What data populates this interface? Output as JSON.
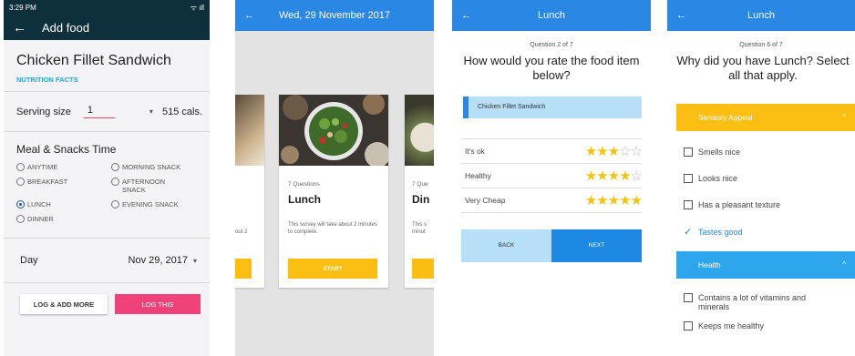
{
  "screen1": {
    "status_time": "3:29 PM",
    "status_icons": "ᯤ ıll",
    "back_icon": "←",
    "title": "Add food",
    "food_name": "Chicken Fillet Sandwich",
    "nutrition_link": "NUTRITION FACTS",
    "serving_label": "Serving size",
    "serving_value": "1",
    "serving_caret": "▾",
    "calories": "515 cals.",
    "meal_heading": "Meal & Snacks Time",
    "meal_options": [
      {
        "label": "ANYTIME",
        "selected": false
      },
      {
        "label": "MORNING SNACK",
        "selected": false
      },
      {
        "label": "BREAKFAST",
        "selected": false
      },
      {
        "label": "AFTERNOON SNACK",
        "selected": false
      },
      {
        "label": "LUNCH",
        "selected": true
      },
      {
        "label": "EVENING SNACK",
        "selected": false
      },
      {
        "label": "DINNER",
        "selected": false
      }
    ],
    "day_label": "Day",
    "day_value": "Nov 29, 2017",
    "day_caret": "▾",
    "log_more_label": "LOG & ADD MORE",
    "log_this_label": "LOG THIS"
  },
  "screen2": {
    "back_icon": "←",
    "title": "Wed, 29 November 2017",
    "left_card_desc": "out 2",
    "center_card": {
      "questions": "7 Questions",
      "title": "Lunch",
      "desc": "This survey will take about 2 minutes to complete.",
      "start_label": "START"
    },
    "right_card": {
      "questions": "7 Que",
      "title": "Din",
      "desc": "This s minut"
    }
  },
  "screen3": {
    "back_icon": "←",
    "title": "Lunch",
    "question_number": "Question 2 of 7",
    "question": "How would you rate the food item below?",
    "food_item": "Chicken Fillet Sandwich",
    "ratings": [
      {
        "label": "It's ok",
        "stars": 3
      },
      {
        "label": "Healthy",
        "stars": 4
      },
      {
        "label": "Very Cheap",
        "stars": 5
      }
    ],
    "back_label": "BACK",
    "next_label": "NEXT",
    "star_glyph": "★",
    "empty_star_glyph": "☆",
    "star_max": 5
  },
  "screen4": {
    "back_icon": "←",
    "title": "Lunch",
    "question_number": "Question 6 of 7",
    "question": "Why did you have Lunch? Select all that apply.",
    "sections": [
      {
        "title": "Sensory Appeal",
        "color": "#fbbf14",
        "chevron": "^",
        "items": [
          {
            "label": "Smells nice",
            "checked": false
          },
          {
            "label": "Looks nice",
            "checked": false
          },
          {
            "label": "Has a pleasant texture",
            "checked": false
          },
          {
            "label": "Tastes good",
            "checked": true
          }
        ]
      },
      {
        "title": "Health",
        "color": "#2ea6ee",
        "chevron": "^",
        "items": [
          {
            "label": "Contains a lot of vitamins and minerals",
            "checked": false
          },
          {
            "label": "Keeps me healthy",
            "checked": false
          }
        ]
      }
    ],
    "check_glyph": "✓"
  },
  "colors": {
    "dark_header": "#0e2f3c",
    "blue_header": "#2b87e4",
    "accent_pink": "#f0427a",
    "accent_yellow": "#fbbf14",
    "light_blue": "#b8dff8"
  }
}
